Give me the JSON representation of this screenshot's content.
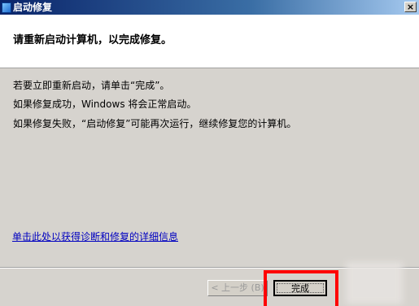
{
  "window": {
    "title": "启动修复",
    "close_label": "×",
    "app_icon": "startup-repair-icon"
  },
  "header": {
    "title": "请重新启动计算机，以完成修复。"
  },
  "body": {
    "line1": "若要立即重新启动，请单击“完成”。",
    "line2": "如果修复成功，Windows 将会正常启动。",
    "line3": "如果修复失败，“启动修复”可能再次运行，继续修复您的计算机。"
  },
  "details_link": "单击此处以获得诊断和修复的详细信息",
  "buttons": {
    "back": "< 上一步 (B)",
    "finish": "完成"
  },
  "colors": {
    "highlight": "#ff0000",
    "link": "#0000c0"
  }
}
